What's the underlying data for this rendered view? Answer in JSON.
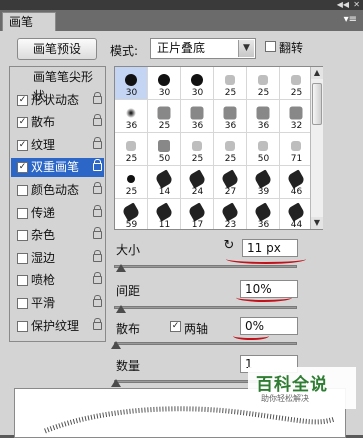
{
  "window": {
    "panel_tab": "画笔",
    "collapse_icon": "double-chevron",
    "close_icon": "x",
    "menu_icon": "panel-menu"
  },
  "toolbar": {
    "preset_button": "画笔预设",
    "mode_label": "模式:",
    "mode_value": "正片叠底",
    "flip_label": "翻转"
  },
  "sidebar": {
    "items": [
      {
        "label": "画笔笔尖形状",
        "checkbox": false,
        "checked": false,
        "lock": false,
        "selected": false
      },
      {
        "label": "形状动态",
        "checkbox": true,
        "checked": true,
        "lock": true,
        "selected": false
      },
      {
        "label": "散布",
        "checkbox": true,
        "checked": true,
        "lock": true,
        "selected": false
      },
      {
        "label": "纹理",
        "checkbox": true,
        "checked": true,
        "lock": true,
        "selected": false
      },
      {
        "label": "双重画笔",
        "checkbox": true,
        "checked": true,
        "lock": true,
        "selected": true
      },
      {
        "label": "颜色动态",
        "checkbox": true,
        "checked": false,
        "lock": true,
        "selected": false
      },
      {
        "label": "传递",
        "checkbox": true,
        "checked": false,
        "lock": true,
        "selected": false
      },
      {
        "label": "杂色",
        "checkbox": true,
        "checked": false,
        "lock": true,
        "selected": false
      },
      {
        "label": "湿边",
        "checkbox": true,
        "checked": false,
        "lock": true,
        "selected": false
      },
      {
        "label": "喷枪",
        "checkbox": true,
        "checked": false,
        "lock": true,
        "selected": false
      },
      {
        "label": "平滑",
        "checkbox": true,
        "checked": false,
        "lock": true,
        "selected": false
      },
      {
        "label": "保护纹理",
        "checkbox": true,
        "checked": false,
        "lock": true,
        "selected": false
      }
    ]
  },
  "brush_grid": {
    "cells": [
      {
        "num": "30",
        "tip": "hard-round",
        "selected": true
      },
      {
        "num": "30",
        "tip": "hard-round"
      },
      {
        "num": "30",
        "tip": "hard-round"
      },
      {
        "num": "25",
        "tip": "spatter"
      },
      {
        "num": "25",
        "tip": "spatter"
      },
      {
        "num": "25",
        "tip": "spatter"
      },
      {
        "num": "36",
        "tip": "soft-round"
      },
      {
        "num": "25",
        "tip": "chalk"
      },
      {
        "num": "36",
        "tip": "chalk"
      },
      {
        "num": "36",
        "tip": "chalk"
      },
      {
        "num": "36",
        "tip": "chalk"
      },
      {
        "num": "32",
        "tip": "chalk"
      },
      {
        "num": "25",
        "tip": "spatter"
      },
      {
        "num": "50",
        "tip": "charcoal"
      },
      {
        "num": "25",
        "tip": "spatter"
      },
      {
        "num": "25",
        "tip": "spatter"
      },
      {
        "num": "50",
        "tip": "spatter"
      },
      {
        "num": "71",
        "tip": "spatter"
      },
      {
        "num": "25",
        "tip": "star"
      },
      {
        "num": "14",
        "tip": "leaf"
      },
      {
        "num": "24",
        "tip": "leaf"
      },
      {
        "num": "27",
        "tip": "leaf"
      },
      {
        "num": "39",
        "tip": "leaf"
      },
      {
        "num": "46",
        "tip": "leaf"
      },
      {
        "num": "59",
        "tip": "leaf"
      },
      {
        "num": "11",
        "tip": "scatter"
      },
      {
        "num": "17",
        "tip": "scatter"
      },
      {
        "num": "23",
        "tip": "scatter"
      },
      {
        "num": "36",
        "tip": "scatter"
      },
      {
        "num": "44",
        "tip": "scatter"
      },
      {
        "num": "60",
        "tip": "scatter"
      },
      {
        "num": "14",
        "tip": "dot"
      },
      {
        "num": "26",
        "tip": "dot"
      },
      {
        "num": "33",
        "tip": "dot"
      },
      {
        "num": "42",
        "tip": "dot"
      },
      {
        "num": "55",
        "tip": "dot"
      }
    ]
  },
  "params": {
    "size": {
      "label": "大小",
      "value": "11 px",
      "level": 0.03
    },
    "spacing": {
      "label": "间距",
      "value": "10%",
      "level": 0.03
    },
    "scatter": {
      "label": "散布",
      "both_axes_label": "两轴",
      "both_axes_checked": true,
      "value": "0%",
      "level": 0.0
    },
    "count": {
      "label": "数量",
      "value": "1",
      "level": 0.0
    }
  },
  "watermark": {
    "main": "百科全说",
    "sub": "助你轻松解决"
  },
  "colors": {
    "selection": "#2c67c7",
    "annotation_red": "#c2111a",
    "panel_bg": "#d4d4d4",
    "logo_green": "#2f7d32"
  }
}
